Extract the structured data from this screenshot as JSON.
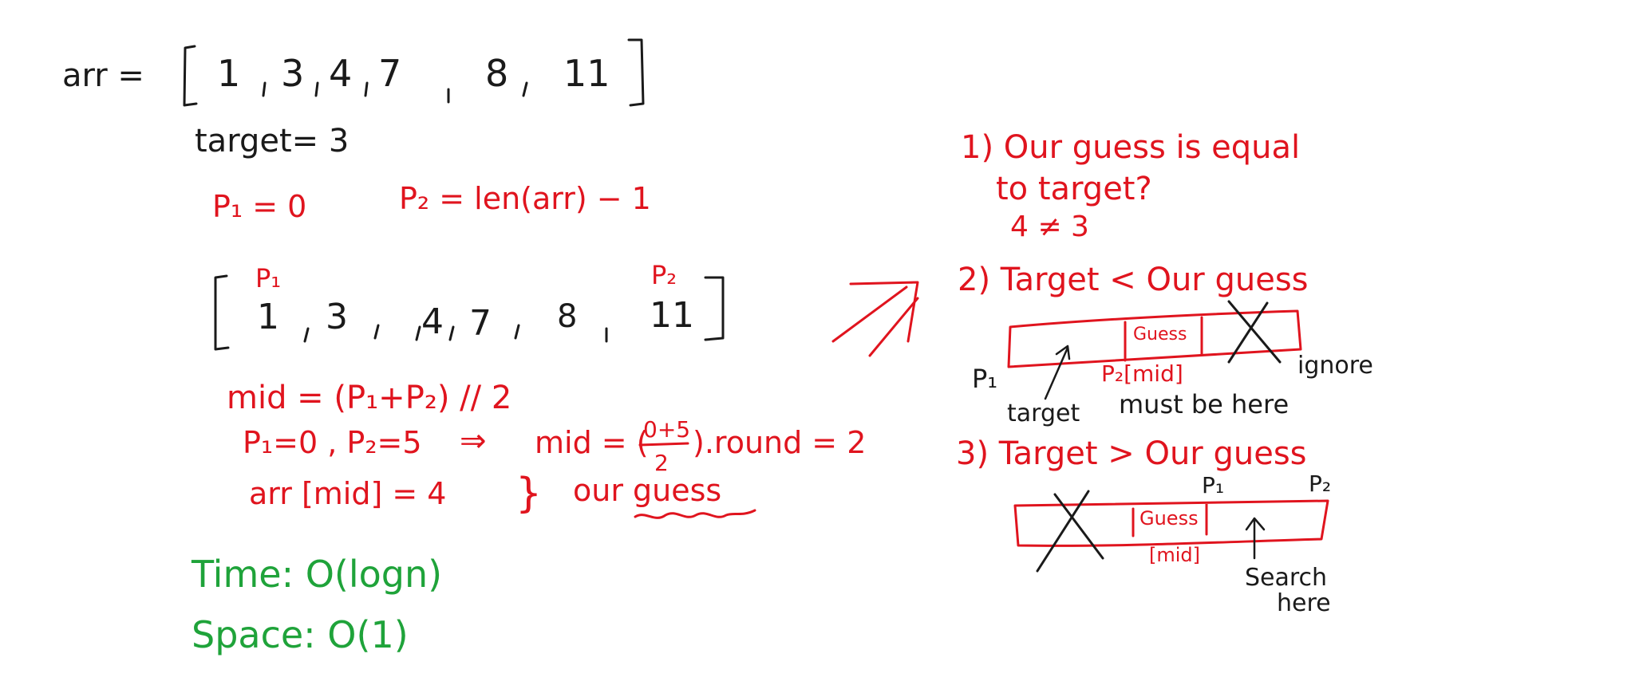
{
  "colors": {
    "ink_black": "#1a1a1a",
    "ink_red": "#e0141e",
    "ink_green": "#1fa33a"
  },
  "setup": {
    "arr_label": "arr =",
    "arr_values": [
      "1",
      "3",
      "4",
      "7",
      "8",
      "11"
    ],
    "target": "target= 3",
    "p1_init": "P₁ = 0",
    "p2_init": "P₂ = len(arr) − 1"
  },
  "pointer_array": {
    "p1_label": "P₁",
    "p2_label": "P₂",
    "values": [
      "1",
      "3",
      "4",
      "7",
      "8",
      "11"
    ]
  },
  "mid_calc": {
    "formula": "mid = (P₁+P₂) // 2",
    "substitution_left": "P₁=0 , P₂=5",
    "implies": "⇒",
    "mid_eq": "mid = (",
    "numerator": "0+5",
    "denominator": "2",
    "round_part": ").round = 2",
    "arr_mid": "arr [mid] = 4",
    "brace": "}",
    "our_guess": "our guess"
  },
  "complexity": {
    "time": "Time: O(logn)",
    "space": "Space:   O(1)"
  },
  "cases": {
    "case1_line1": "1) Our guess is equal",
    "case1_line2": "to target?",
    "case1_result": "4 ≠ 3",
    "case2_title": "2) Target < Our guess",
    "case2_guess": "Guess",
    "case2_p1": "P₁",
    "case2_p2mid": "P₂[mid]",
    "case2_ignore": "ignore",
    "case2_target": "target",
    "case2_must": "must be here",
    "case3_title": "3) Target > Our guess",
    "case3_p1": "P₁",
    "case3_p2": "P₂",
    "case3_guess": "Guess",
    "case3_mid": "[mid]",
    "case3_search": "Search",
    "case3_here": "here"
  }
}
